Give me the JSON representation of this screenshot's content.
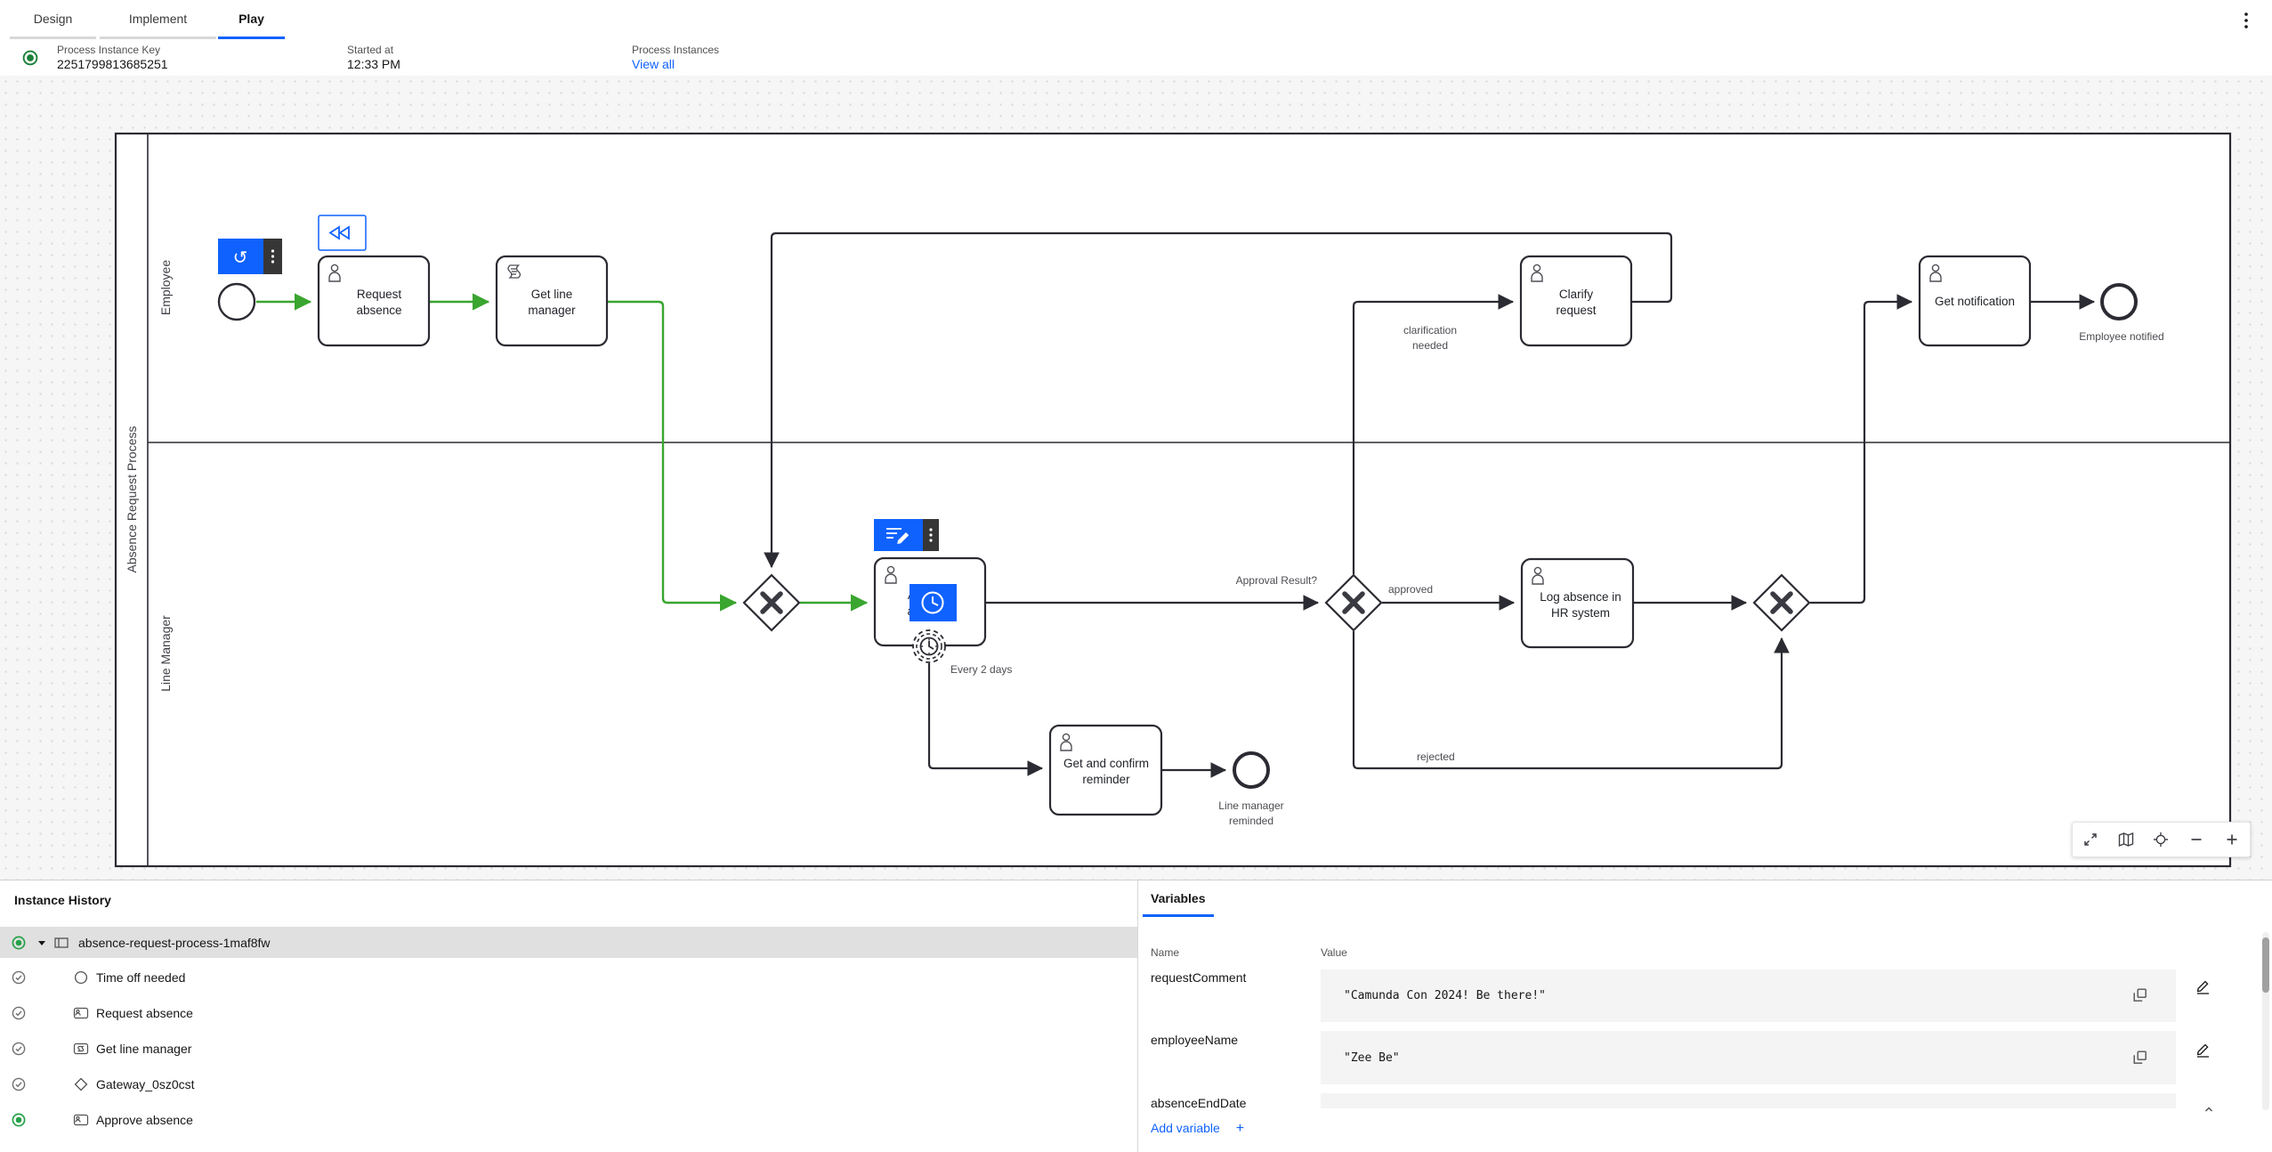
{
  "app": {
    "accent": "#0f62fe",
    "completed_path_green": "#3aa52f",
    "state_green": "#198038"
  },
  "tabs": {
    "design": "Design",
    "implement": "Implement",
    "play": "Play"
  },
  "icons": {
    "kebab": "vertical-ellipsis",
    "restart_glyph": "↺"
  },
  "info_bar": {
    "key_label": "Process Instance Key",
    "key_value": "2251799813685251",
    "started_label": "Started at",
    "started_value": "12:33 PM",
    "instances_label": "Process Instances",
    "view_all_label": "View all"
  },
  "diagram": {
    "pool_label": "Absence Request Process",
    "lane_employee": "Employee",
    "lane_line_manager": "Line Manager",
    "nodes": {
      "request_absence": {
        "l1": "Request",
        "l2": "absence"
      },
      "get_line_manager": {
        "l1": "Get line",
        "l2": "manager"
      },
      "clarify_request": {
        "l1": "Clarify",
        "l2": "request"
      },
      "get_notification": {
        "l1": "Get notification"
      },
      "approve_absence": {
        "l1": "Approve",
        "l2": "absence"
      },
      "log_absence": {
        "l1": "Log absence in",
        "l2": "HR system"
      },
      "get_confirm_reminder": {
        "l1": "Get and confirm",
        "l2": "reminder"
      },
      "employee_notified": {
        "l1": "Employee notified"
      },
      "line_manager_reminded": {
        "l1": "Line manager",
        "l2": "reminded"
      }
    },
    "edges": {
      "approval_result": "Approval Result?",
      "approved": "approved",
      "rejected": "rejected",
      "clarification": {
        "l1": "clarification",
        "l2": "needed"
      },
      "every_2_days": "Every 2 days"
    },
    "toolbar": {
      "fit": "fit-viewport",
      "minimap": "minimap",
      "center": "reset-view",
      "zoom_out": "zoom-out",
      "zoom_in": "zoom-in"
    }
  },
  "history": {
    "title": "Instance History",
    "root": {
      "label": "absence-request-process-1maf8fw"
    },
    "rows": [
      {
        "label": "Time off needed"
      },
      {
        "label": "Request absence"
      },
      {
        "label": "Get line manager"
      },
      {
        "label": "Gateway_0sz0cst"
      },
      {
        "label": "Approve absence"
      }
    ]
  },
  "variables": {
    "tab_label": "Variables",
    "name_header": "Name",
    "value_header": "Value",
    "rows": [
      {
        "name": "requestComment",
        "value": "\"Camunda Con 2024! Be there!\""
      },
      {
        "name": "employeeName",
        "value": "\"Zee Be\""
      },
      {
        "name": "absenceEndDate",
        "value": ""
      }
    ],
    "add_label": "Add variable",
    "add_plus": "+"
  }
}
